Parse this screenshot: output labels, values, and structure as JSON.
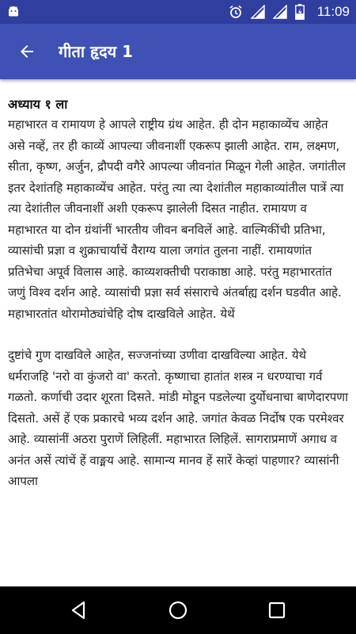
{
  "status_bar": {
    "time": "11:09",
    "icons": [
      "android-icon",
      "alarm-icon",
      "signal-icon",
      "signal-icon",
      "battery-charging-icon"
    ]
  },
  "app_bar": {
    "title": "गीता हृदय 1",
    "back_icon": "arrow-back-icon"
  },
  "content": {
    "chapter_title": "अध्याय १ ला",
    "paragraphs": [
      "महाभारत व रामायण हे आपले राष्ट्रीय ग्रंथ आहेत. ही दोन महाकाव्येंच आहेत असे नव्हें, तर ही काव्यें आपल्या जीवनाशीं एकरूप झाली आहेत. राम, लक्ष्मण, सीता, कृष्ण, अर्जुन, द्रौपदी वगैरे आपल्या जीवनांत मिळून गेली आहेत. जगांतील इतर देशांतहि महाकाव्येंच आहेत. परंतु त्या त्या देशांतील महाकाव्यांतील पात्रें त्या त्या देशांतील जीवनाशीं अशी एकरूप झालेली दिसत नाहीत. रामायण व महाभारत या दोन ग्रंथांनीं भारतीय जीवन बनविलें आहे. वाल्मिकींची प्रतिभा, व्यासांची प्रज्ञा व शुक्राचार्यांचें वैराग्य याला जगांत तुलना नाहीं. रामायणांत प्रतिभेचा अपूर्व विलास आहे. काव्यशक्तीची पराकाष्ठा आहे. परंतु महाभारतांत जणुं विश्व दर्शन आहे. व्यासांची प्रज्ञा सर्व संसाराचे अंतर्बाह्य दर्शन घडवीत आहे. महाभारतांत थोरामोठ्यांचेहि दोष दाखविले आहेत. येथें",
      "दुष्टांचे गुण दाखविले आहेत, सज्जनांच्या उणीवा दाखविल्या आहेत. येथे धर्मराजहि 'नरो वा कुंजरो वा' करतो. कृष्णाचा हातांत शस्त्र न धरण्याचा गर्व गळतो. कर्णाची उदार शूरता दिसते. मांडी मोडून पडलेल्या दुर्योधनाचा बाणेदारपणा दिसतो. असें हें एक प्रकारचे भव्य दर्शन आहे. जगांत केवळ निर्दोष एक परमेश्वर आहे. व्यासांनीं अठरा पुराणें लिहिलीं. महाभारत लिहिलें. सागराप्रमाणें अगाध व अनंत असें त्यांचें हें वाङ्मय आहे. सामान्य मानव हें सारें केव्हां पाहणार? व्यासांनी आपला"
    ]
  },
  "nav_bar": {
    "back": "nav-back-icon",
    "home": "nav-home-icon",
    "recents": "nav-recents-icon"
  }
}
